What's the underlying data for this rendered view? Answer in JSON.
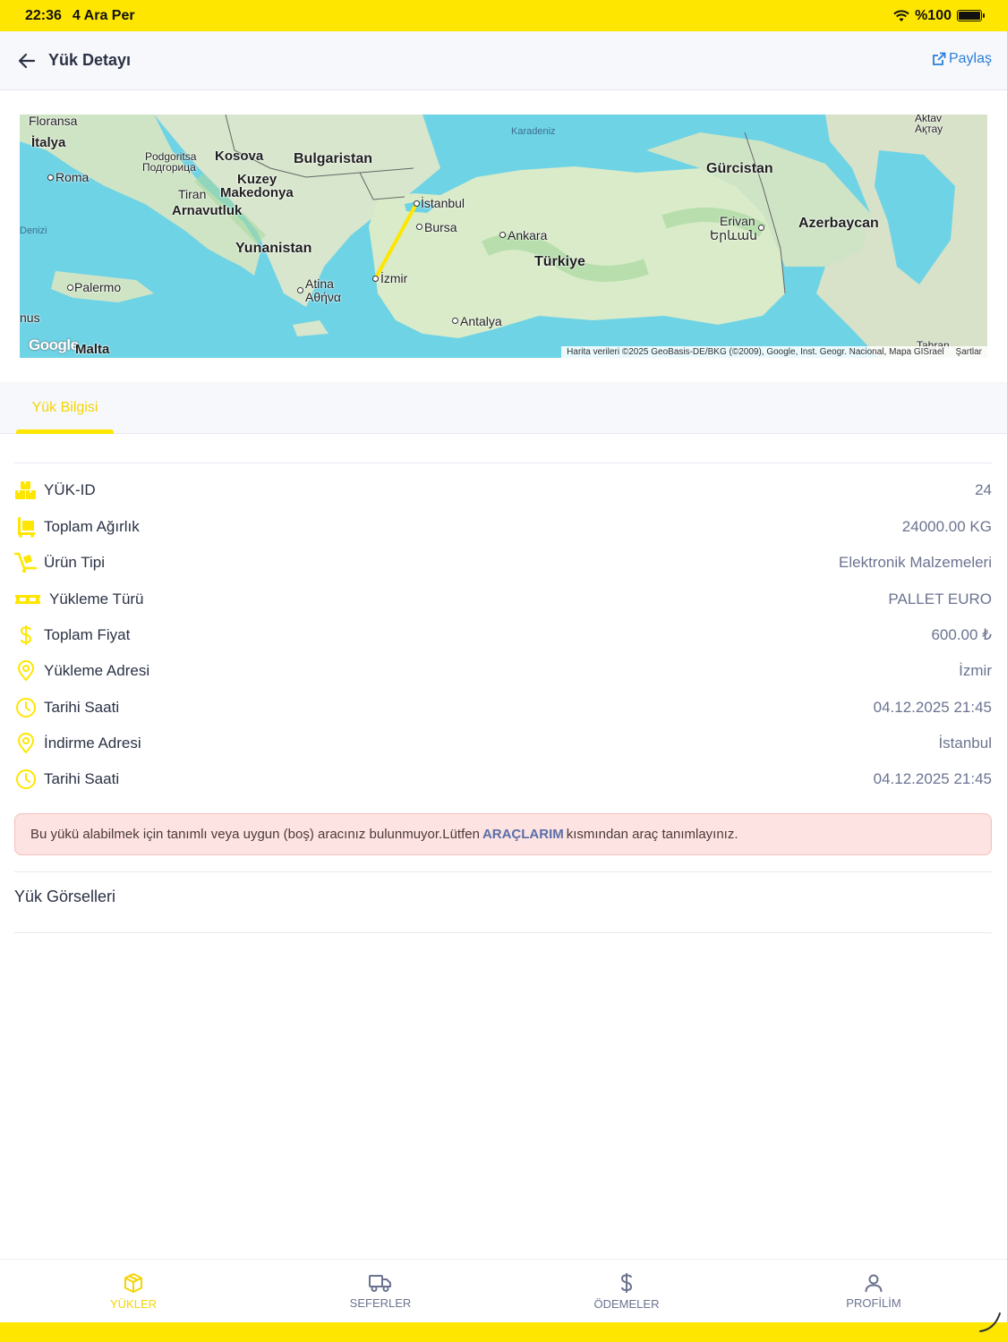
{
  "status": {
    "time": "22:36",
    "date": "4 Ara Per",
    "battery": "%100"
  },
  "header": {
    "title": "Yük Detayı",
    "share_label": "Paylaş"
  },
  "map": {
    "labels": {
      "floransa": "Floransa",
      "italya": "İtalya",
      "roma": "Roma",
      "denizi": "Denizi",
      "palermo": "Palermo",
      "nus": "nus",
      "malta": "Malta",
      "podgoritsa": "Podgoritsa",
      "podgoritsa_cyr": "Подгорица",
      "kosova": "Kosova",
      "kuzey": "Kuzey",
      "tiran": "Tiran",
      "makedonya": "Makedonya",
      "arnavutluk": "Arnavutluk",
      "bulgaristan": "Bulgaristan",
      "yunanistan": "Yunanistan",
      "atina": "Atina",
      "atina_gr": "Αθήνα",
      "karadeniz": "Karadeniz",
      "istanbul": "İstanbul",
      "bursa": "Bursa",
      "izmir": "İzmir",
      "ankara": "Ankara",
      "turkiye": "Türkiye",
      "antalya": "Antalya",
      "gurcistan": "Gürcistan",
      "erivan": "Erivan",
      "erivan_hy": "Երևան",
      "azerbaycan": "Azerbaycan",
      "aktav": "Aktav",
      "aktav_kz": "Ақтау",
      "tahran": "Tahran"
    },
    "google": "Google",
    "attribution": "Harita verileri ©2025 GeoBasis-DE/BKG (©2009), Google, Inst. Geogr. Nacional, Mapa GISrael",
    "terms": "Şartlar"
  },
  "tabs": {
    "active": "Yük Bilgisi"
  },
  "details": [
    {
      "icon": "boxes-icon",
      "label": "YÜK-ID",
      "value": "24"
    },
    {
      "icon": "pallet-jack-icon",
      "label": "Toplam Ağırlık",
      "value": "24000.00 KG"
    },
    {
      "icon": "hand-truck-icon",
      "label": "Ürün Tipi",
      "value": "Elektronik Malzemeleri"
    },
    {
      "icon": "pallet-icon",
      "label": "Yükleme Türü",
      "value": "PALLET EURO"
    },
    {
      "icon": "dollar-icon",
      "label": "Toplam Fiyat",
      "value": "600.00 ₺"
    },
    {
      "icon": "location-pin-icon",
      "label": "Yükleme Adresi",
      "value": "İzmir"
    },
    {
      "icon": "clock-icon",
      "label": "Tarihi Saati",
      "value": "04.12.2025 21:45"
    },
    {
      "icon": "location-pin-icon",
      "label": "İndirme Adresi",
      "value": "İstanbul"
    },
    {
      "icon": "clock-icon",
      "label": "Tarihi Saati",
      "value": "04.12.2025 21:45"
    }
  ],
  "alert": {
    "before": "Bu yükü alabilmek için tanımlı veya uygun (boş) aracınız bulunmuyor.Lütfen",
    "link": "ARAÇLARIM",
    "after": "kısmından araç tanımlayınız."
  },
  "images_section": {
    "title": "Yük Görselleri"
  },
  "nav": [
    {
      "label": "YÜKLER",
      "icon": "box-icon",
      "active": true
    },
    {
      "label": "SEFERLER",
      "icon": "truck-icon",
      "active": false
    },
    {
      "label": "ÖDEMELER",
      "icon": "dollar-icon",
      "active": false
    },
    {
      "label": "PROFİLİM",
      "icon": "user-icon",
      "active": false
    }
  ],
  "colors": {
    "accent": "#ffe600",
    "accent_text": "#f5d400",
    "link": "#2a7fd8",
    "route": "#ffe600",
    "alert_bg": "#fde3e1"
  }
}
